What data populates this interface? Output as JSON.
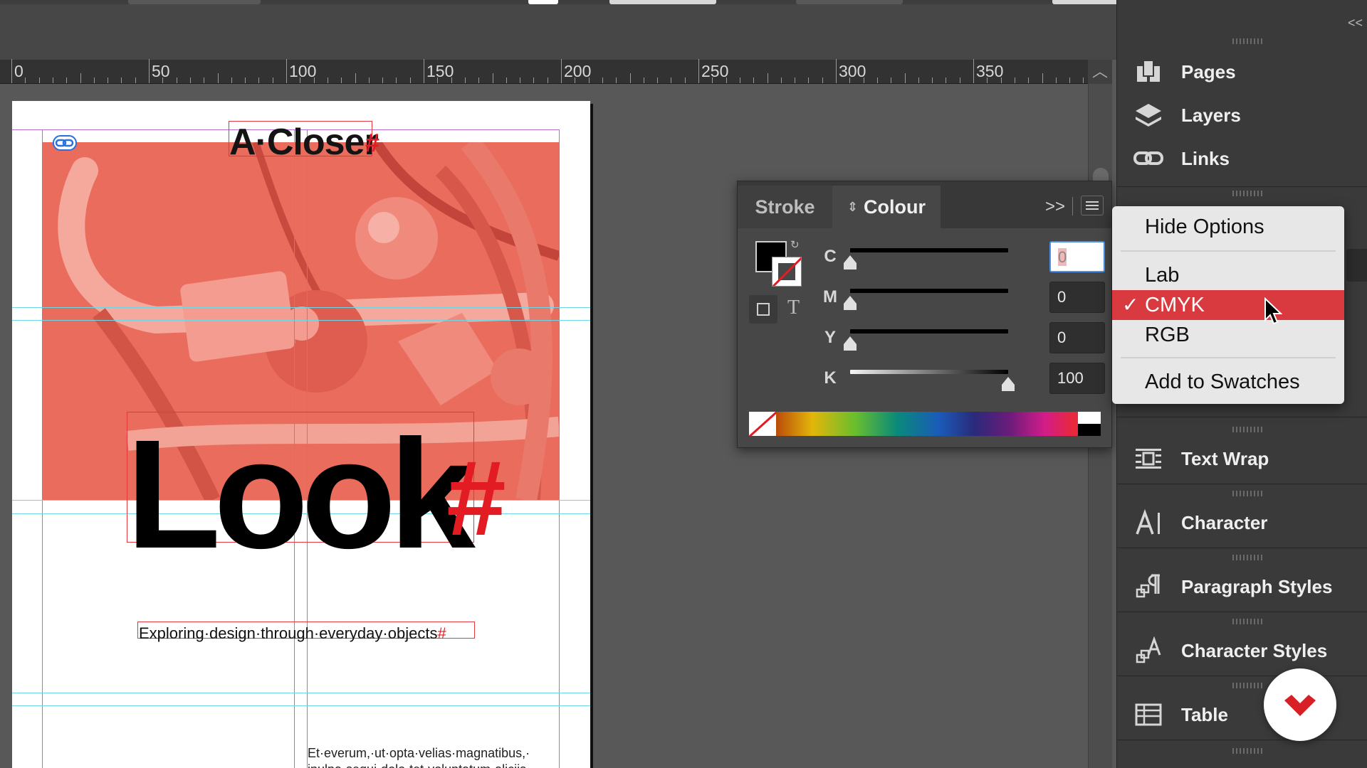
{
  "ruler": {
    "labels": [
      "0",
      "50",
      "100",
      "150",
      "200",
      "250",
      "300",
      "350"
    ]
  },
  "document": {
    "headline": "A·Closer",
    "big_word": "Look",
    "hash_mark": "#",
    "subtitle": "Exploring·design·through·everyday·objects",
    "subtitle_end": "#",
    "body_line1": "Et·everum,·ut·opta·velias·magnatibus,·",
    "body_line2": "inulpa·sequi·dolo·tet·voluptatum·aliciis·"
  },
  "colour_panel": {
    "tabs": [
      {
        "label": "Stroke",
        "active": false
      },
      {
        "label": "Colour",
        "active": true
      }
    ],
    "more_icon": "double-chevron-right-icon",
    "menu_icon": "hamburger-menu-icon",
    "text_mode_label": "T",
    "unit": "%",
    "channels": [
      {
        "key": "C",
        "value": "0",
        "level": 0,
        "active": true
      },
      {
        "key": "M",
        "value": "0",
        "level": 0,
        "active": false
      },
      {
        "key": "Y",
        "value": "0",
        "level": 0,
        "active": false
      },
      {
        "key": "K",
        "value": "100",
        "level": 100,
        "active": false
      }
    ]
  },
  "dropdown": {
    "items": [
      {
        "label": "Hide Options",
        "selected": false
      },
      {
        "label": "Lab",
        "selected": false
      },
      {
        "label": "CMYK",
        "selected": true
      },
      {
        "label": "RGB",
        "selected": false
      },
      {
        "label": "Add to Swatches",
        "selected": false
      }
    ],
    "check_mark": "✓"
  },
  "dock": {
    "items": [
      {
        "label": "Pages",
        "icon": "pages-icon"
      },
      {
        "label": "Layers",
        "icon": "layers-icon"
      },
      {
        "label": "Links",
        "icon": "links-icon"
      },
      {
        "label": "Text Wrap",
        "icon": "text-wrap-icon"
      },
      {
        "label": "Character",
        "icon": "character-icon"
      },
      {
        "label": "Paragraph Styles",
        "icon": "paragraph-styles-icon"
      },
      {
        "label": "Character Styles",
        "icon": "character-styles-icon"
      },
      {
        "label": "Table",
        "icon": "table-icon"
      }
    ],
    "collapse_label": "<<"
  },
  "colors": {
    "accent_red": "#d93a3f",
    "photo_tint": "#e96c5c",
    "guide_magenta": "#b56bd6",
    "guide_cyan": "#6fd6e8",
    "frame_red": "#e4373d"
  }
}
